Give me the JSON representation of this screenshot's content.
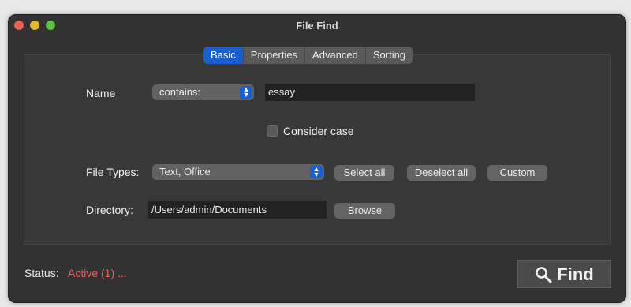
{
  "window": {
    "title": "File Find"
  },
  "tabs": [
    "Basic",
    "Properties",
    "Advanced",
    "Sorting"
  ],
  "name_row": {
    "label": "Name",
    "match_mode": "contains:",
    "value": "essay"
  },
  "consider_case": {
    "label": "Consider case",
    "checked": false
  },
  "file_types": {
    "label": "File Types:",
    "selected": "Text, Office",
    "select_all": "Select all",
    "deselect_all": "Deselect all",
    "custom": "Custom"
  },
  "directory": {
    "label": "Directory:",
    "value": "/Users/admin/Documents",
    "browse": "Browse"
  },
  "status": {
    "label": "Status:",
    "value": "Active (1) ..."
  },
  "find_button": {
    "label": "Find"
  },
  "colors": {
    "accent": "#1a5fd0",
    "status_active": "#ec5f5f"
  },
  "icons": {
    "find": "magnifier-icon",
    "stepper": "up-down-chevron-icon"
  }
}
